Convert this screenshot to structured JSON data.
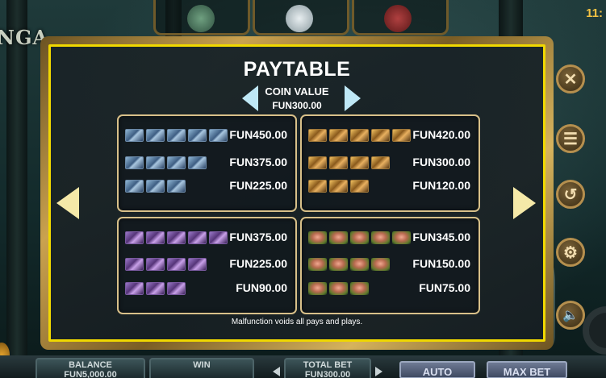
{
  "status": {
    "clock": "11:"
  },
  "game": {
    "logo_text": "NGA"
  },
  "paytable": {
    "title": "PAYTABLE",
    "coin_value_label": "COIN VALUE",
    "coin_value": "FUN300.00",
    "footer_note": "Malfunction voids all pays and plays.",
    "boxes": [
      {
        "symbol": "blue-rune-card",
        "rows": [
          {
            "count": 5,
            "pay": "FUN450.00"
          },
          {
            "count": 4,
            "pay": "FUN375.00"
          },
          {
            "count": 3,
            "pay": "FUN225.00"
          }
        ]
      },
      {
        "symbol": "gold-rune-card",
        "rows": [
          {
            "count": 5,
            "pay": "FUN420.00"
          },
          {
            "count": 4,
            "pay": "FUN300.00"
          },
          {
            "count": 3,
            "pay": "FUN120.00"
          }
        ]
      },
      {
        "symbol": "purple-rune-card",
        "rows": [
          {
            "count": 5,
            "pay": "FUN375.00"
          },
          {
            "count": 4,
            "pay": "FUN225.00"
          },
          {
            "count": 3,
            "pay": "FUN90.00"
          }
        ]
      },
      {
        "symbol": "mushroom",
        "rows": [
          {
            "count": 5,
            "pay": "FUN345.00"
          },
          {
            "count": 4,
            "pay": "FUN150.00"
          },
          {
            "count": 3,
            "pay": "FUN75.00"
          }
        ]
      }
    ]
  },
  "side_buttons": [
    {
      "name": "close",
      "glyph": "✕"
    },
    {
      "name": "menu",
      "glyph": "☰"
    },
    {
      "name": "back",
      "glyph": "↺"
    },
    {
      "name": "settings",
      "glyph": "⚙"
    },
    {
      "name": "sound",
      "glyph": "🔈"
    }
  ],
  "bottom_bar": {
    "balance_label": "BALANCE",
    "balance_value": "FUN5,000.00",
    "win_label": "WIN",
    "total_bet_label": "TOTAL BET",
    "total_bet_value": "FUN300.00",
    "auto_label": "AUTO",
    "max_bet_label": "MAX BET"
  },
  "colors": {
    "panel_border": "#f0d800",
    "frame_gold": "#caa24f",
    "text": "#ffffff",
    "arrow": "#bfe8f6"
  }
}
